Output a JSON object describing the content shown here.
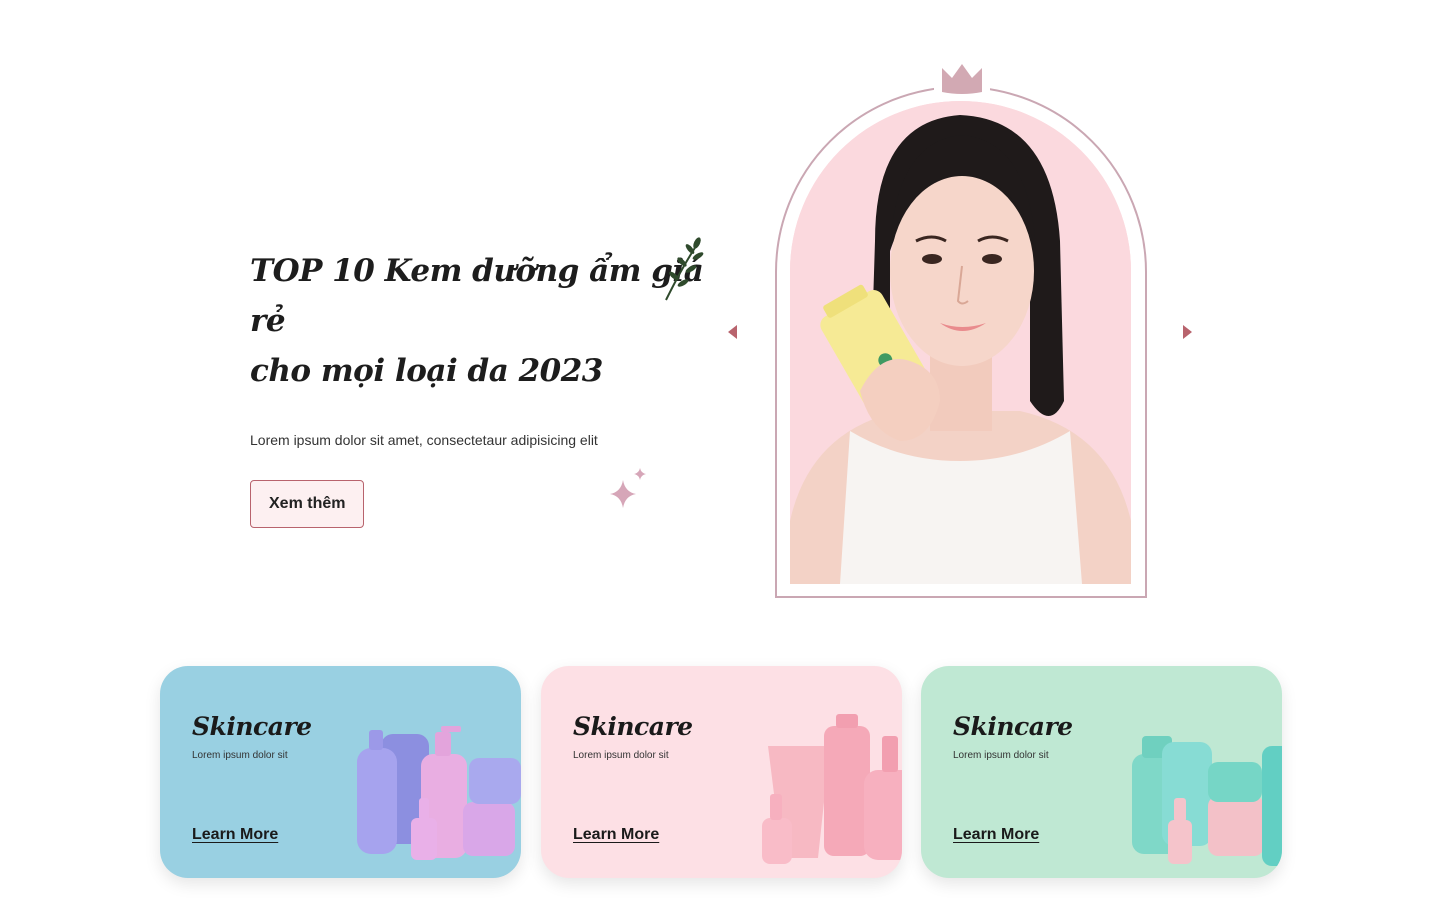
{
  "hero": {
    "title_line1": "TOP 10 Kem dưỡng ẩm giá rẻ",
    "title_line2": "cho mọi loại da 2023",
    "description": "Lorem ipsum dolor sit amet, consectetaur adipisicing elit",
    "button_label": "Xem thêm",
    "image_name": "woman-holding-moisturizer-photo"
  },
  "carousel": {
    "prev_icon": "caret-left-icon",
    "next_icon": "caret-right-icon",
    "frame_badge_icon": "crown-icon"
  },
  "decorations": {
    "leaf_icon": "leaf-sprig-icon",
    "sparkle_icon": "sparkle-icon"
  },
  "colors": {
    "accent": "#b8636d",
    "frame": "#caa7b3",
    "button_bg": "#fdf0f1"
  },
  "cards": [
    {
      "title": "Skincare",
      "subtitle": "Lorem ipsum dolor sit",
      "link": "Learn More",
      "bg": "#99d0e2",
      "product_color": "#a9a4ec"
    },
    {
      "title": "Skincare",
      "subtitle": "Lorem ipsum dolor sit",
      "link": "Learn More",
      "bg": "#fde0e5",
      "product_color": "#f7b4c2"
    },
    {
      "title": "Skincare",
      "subtitle": "Lorem ipsum dolor sit",
      "link": "Learn More",
      "bg": "#bfe8d3",
      "product_color": "#7fd8c8"
    }
  ]
}
